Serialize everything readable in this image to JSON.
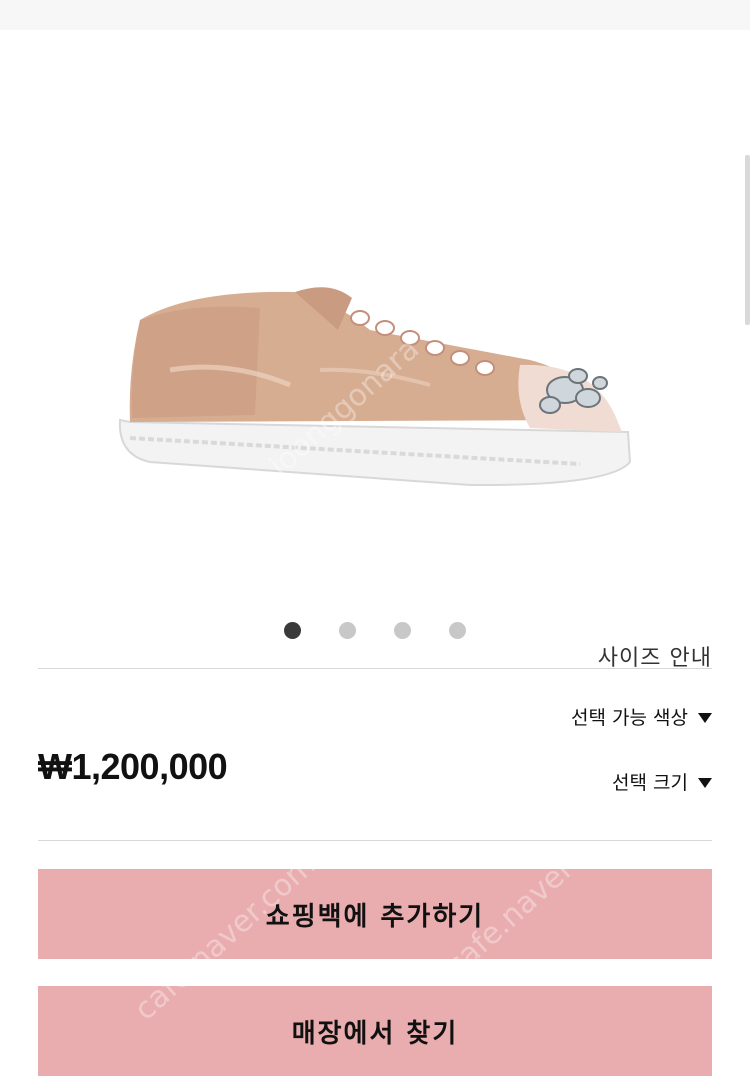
{
  "product": {
    "image_alt": "pink patent leather sneaker with crystal toe cap",
    "price": "₩1,200,000",
    "carousel": {
      "count": 4,
      "active_index": 0
    }
  },
  "links": {
    "size_guide": "사이즈 안내"
  },
  "selectors": {
    "color_label": "선택 가능 색상",
    "size_label": "선택 크기"
  },
  "actions": {
    "add_to_bag": "쇼핑백에 추가하기",
    "find_in_store": "매장에서 찾기"
  },
  "colors": {
    "cta_background": "#e9adaf",
    "active_dot": "#3a3a3a",
    "inactive_dot": "#c8c8c8"
  }
}
